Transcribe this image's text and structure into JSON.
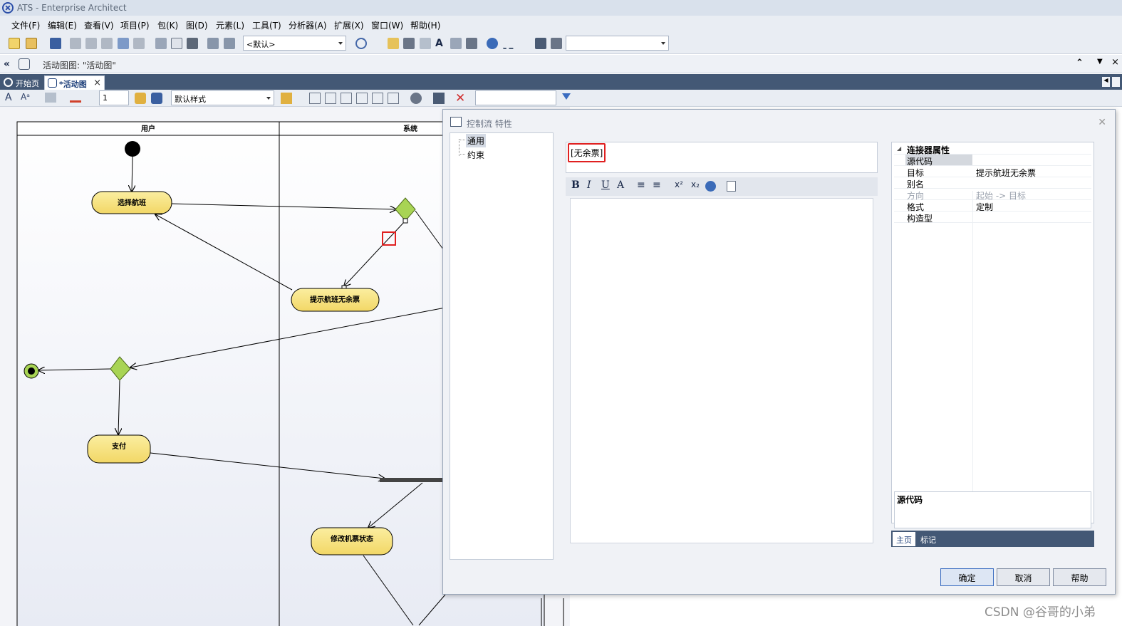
{
  "window": {
    "title": "ATS - Enterprise Architect"
  },
  "menu": [
    "文件(F)",
    "编辑(E)",
    "查看(V)",
    "项目(P)",
    "包(K)",
    "图(D)",
    "元素(L)",
    "工具(T)",
    "分析器(A)",
    "扩展(X)",
    "窗口(W)",
    "帮助(H)"
  ],
  "toolbar": {
    "perspective_value": "<默认>",
    "search_value": ""
  },
  "breadcrumb": "活动图图: \"活动图\"",
  "tabs": [
    {
      "label": "开始页"
    },
    {
      "label": "*活动图"
    }
  ],
  "diagram_toolbar": {
    "line_width": "1",
    "style_value": "默认样式",
    "filter_value": ""
  },
  "diagram": {
    "lanes": [
      "用户",
      "系统"
    ],
    "nodes": {
      "select_flight": "选择航班",
      "no_tickets_notice": "提示航班无余票",
      "pay": "支付",
      "update_ticket_status": "修改机票状态"
    }
  },
  "dialog": {
    "title": "控制流 特性",
    "nav": [
      "通用",
      "约束"
    ],
    "guard_text": "[无余票]",
    "notes_toolbar": [
      "B",
      "I",
      "U",
      "A",
      "≡",
      "≡",
      "x²",
      "x₂"
    ],
    "props": {
      "section_title": "连接器属性",
      "rows": [
        {
          "key": "源代码",
          "value": ""
        },
        {
          "key": "目标",
          "value": "提示航班无余票"
        },
        {
          "key": "别名",
          "value": ""
        },
        {
          "key": "方向",
          "value": "起始 -> 目标"
        },
        {
          "key": "格式",
          "value": "定制"
        },
        {
          "key": "构造型",
          "value": ""
        }
      ],
      "detail_title": "源代码",
      "tabs": [
        "主页",
        "标记"
      ]
    },
    "buttons": {
      "ok": "确定",
      "cancel": "取消",
      "help": "帮助"
    }
  },
  "watermark": "CSDN @谷哥的小弟",
  "colors": {
    "accent": "#435875",
    "node_fill": "#f7df7a",
    "decision_fill": "#a8d454",
    "highlight": "#e02020"
  }
}
